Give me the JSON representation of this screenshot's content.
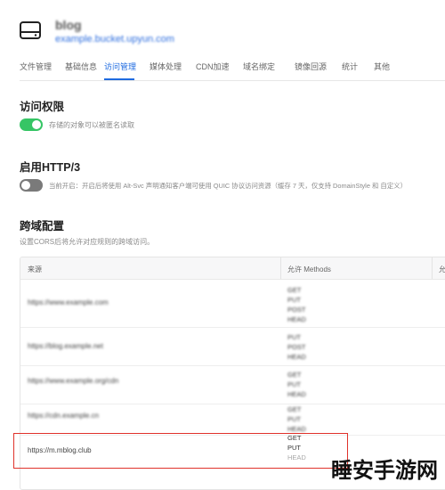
{
  "header": {
    "bucket_name": "blog",
    "bucket_url": "example.bucket.upyun.com"
  },
  "tabs": [
    {
      "label": "文件管理",
      "active": false
    },
    {
      "label": "基础信息",
      "active": false
    },
    {
      "label": "访问管理",
      "active": true
    },
    {
      "label": "媒体处理",
      "active": false
    },
    {
      "label": "CDN加速",
      "active": false
    },
    {
      "label": "域名绑定",
      "active": false
    },
    {
      "label": "镜像回源",
      "active": false
    },
    {
      "label": "统计",
      "active": false
    },
    {
      "label": "其他",
      "active": false
    }
  ],
  "access_permission": {
    "title": "访问权限",
    "toggle_on": true,
    "description": "存储的对象可以被匿名读取"
  },
  "http3": {
    "title": "启用HTTP/3",
    "toggle_on": false,
    "description": "当前开启：开启后将使用 Alt-Svc 声明通知客户端可使用 QUIC 协议访问资源（缓存 7 天，仅支持 DomainStyle 和 自定义）"
  },
  "cors": {
    "title": "跨域配置",
    "description": "设置CORS后将允许对应规则的跨域访问。",
    "columns": [
      "来源",
      "允许 Methods",
      "允"
    ],
    "rows": [
      {
        "origin": "https://www.example.com",
        "methods": [
          "GET",
          "PUT",
          "POST",
          "HEAD"
        ],
        "blurred": true
      },
      {
        "origin": "https://blog.example.net",
        "methods": [
          "PUT",
          "POST",
          "HEAD"
        ],
        "blurred": true
      },
      {
        "origin": "https://www.example.org/cdn",
        "methods": [
          "GET",
          "PUT",
          "HEAD"
        ],
        "blurred": true
      },
      {
        "origin": "https://cdn.example.cn",
        "methods": [
          "GET",
          "PUT",
          "HEAD"
        ],
        "blurred": true
      },
      {
        "origin": "https://m.mblog.club",
        "methods": [
          "GET",
          "PUT",
          "HEAD"
        ],
        "blurred": false
      }
    ]
  },
  "watermark": "睡安手游网"
}
